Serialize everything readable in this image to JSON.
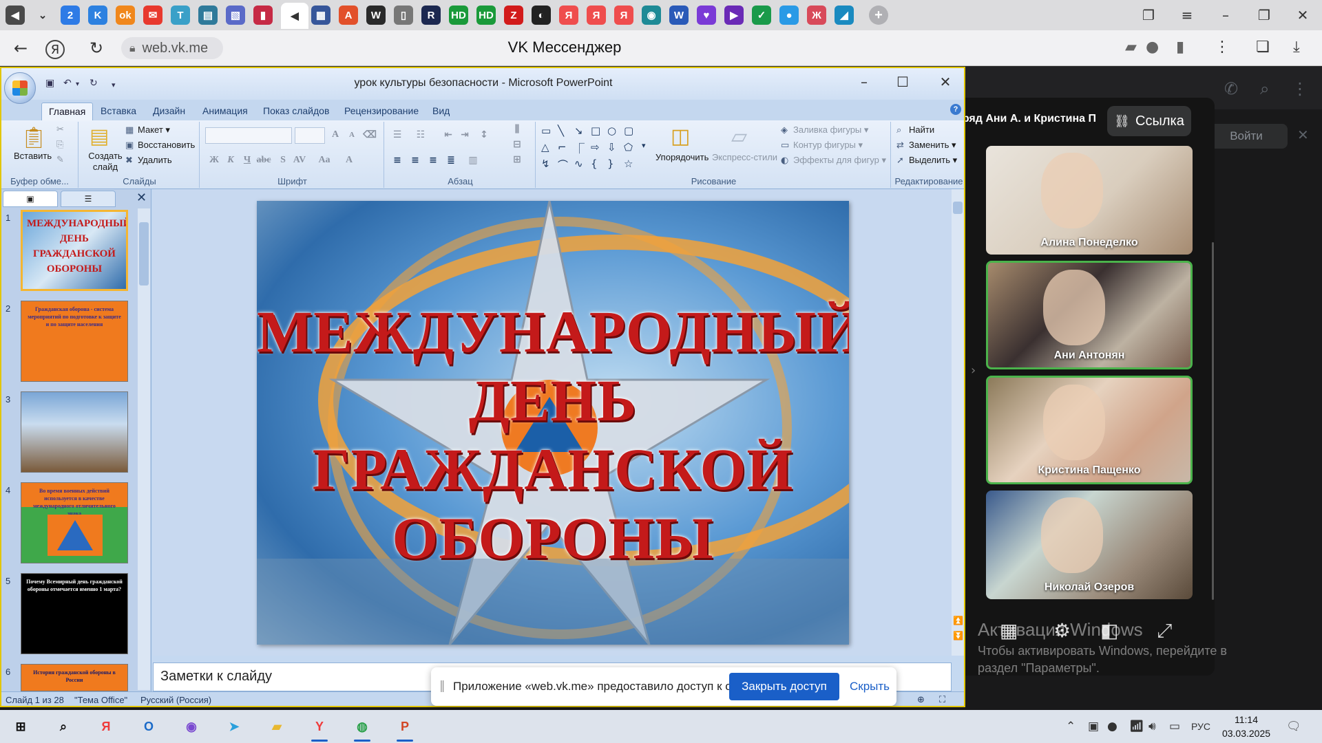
{
  "browser": {
    "tab_icons": [
      {
        "name": "speaker-tab-icon",
        "glyph": "◀",
        "bg": "#4a4a4a"
      },
      {
        "name": "tab-list-chevron-icon",
        "glyph": "⌄",
        "bg": "transparent"
      },
      {
        "name": "tab-2",
        "glyph": "2",
        "bg": "#2e7be6"
      },
      {
        "name": "tab-vk",
        "glyph": "K",
        "bg": "#2d81e0"
      },
      {
        "name": "tab-ok",
        "glyph": "ok",
        "bg": "#f0871c"
      },
      {
        "name": "tab-mail",
        "glyph": "✉",
        "bg": "#e8392e"
      },
      {
        "name": "tab-t",
        "glyph": "T",
        "bg": "#3aa0c8"
      },
      {
        "name": "tab-edu",
        "glyph": "▤",
        "bg": "#2f7a9a"
      },
      {
        "name": "tab-doc",
        "glyph": "▧",
        "bg": "#5a6ac8"
      },
      {
        "name": "tab-red",
        "glyph": "▮",
        "bg": "#c62a45"
      },
      {
        "name": "tab-active-vk",
        "glyph": "◀",
        "bg": "#ffffff"
      },
      {
        "name": "tab-m",
        "glyph": "▦",
        "bg": "#36569a"
      },
      {
        "name": "tab-a",
        "glyph": "A",
        "bg": "#e2502a"
      },
      {
        "name": "tab-w",
        "glyph": "W",
        "bg": "#2a2a2a"
      },
      {
        "name": "tab-file",
        "glyph": "▯",
        "bg": "#777777"
      },
      {
        "name": "tab-r",
        "glyph": "R",
        "bg": "#1c2850"
      },
      {
        "name": "tab-hd1",
        "glyph": "HD",
        "bg": "#1a9a3a"
      },
      {
        "name": "tab-hd2",
        "glyph": "HD",
        "bg": "#1a9a3a"
      },
      {
        "name": "tab-z",
        "glyph": "Z",
        "bg": "#d21b1b"
      },
      {
        "name": "tab-round",
        "glyph": "◐",
        "bg": "#222222"
      },
      {
        "name": "tab-ya1",
        "glyph": "Я",
        "bg": "#ef4d4d"
      },
      {
        "name": "tab-ya2",
        "glyph": "Я",
        "bg": "#ef4d4d"
      },
      {
        "name": "tab-ya3",
        "glyph": "Я",
        "bg": "#ef4d4d"
      },
      {
        "name": "tab-cam",
        "glyph": "◉",
        "bg": "#1e8a96"
      },
      {
        "name": "tab-wd",
        "glyph": "W",
        "bg": "#2a5ab8"
      },
      {
        "name": "tab-shield",
        "glyph": "♥",
        "bg": "#7a3ad6"
      },
      {
        "name": "tab-flag",
        "glyph": "▶",
        "bg": "#6a2ab6"
      },
      {
        "name": "tab-check",
        "glyph": "✓",
        "bg": "#1a9a4a"
      },
      {
        "name": "tab-dots",
        "glyph": "●",
        "bg": "#2a9ae6"
      },
      {
        "name": "tab-tree",
        "glyph": "Ж",
        "bg": "#d84a5a"
      },
      {
        "name": "tab-pen",
        "glyph": "◢",
        "bg": "#1a8ac0"
      }
    ],
    "url": "web.vk.me",
    "page_title": "VK Мессенджер"
  },
  "vk": {
    "login_label": "Войти",
    "call_title": "ряд Ани А. и Кристина П.",
    "link_label": "Ссылка",
    "participants": [
      {
        "name": "Алина Понеделко",
        "speaking": false,
        "bg": "linear-gradient(135deg,#e9e4dc 0%,#d9cdbd 55%,#a58a70 100%)"
      },
      {
        "name": "Ани Антонян",
        "speaking": true,
        "bg": "linear-gradient(135deg,#a68a6c 0%,#3a3030 40%,#bdb2a2 70%,#7a6050 100%)"
      },
      {
        "name": "Кристина Пащенко",
        "speaking": true,
        "bg": "linear-gradient(135deg,#8c7a5a 0%,#e6d2bf 40%,#d0a48a 70%,#c8b8a8 100%)"
      },
      {
        "name": "Николай Озеров",
        "speaking": false,
        "bg": "linear-gradient(135deg,#3a5a8c 0%,#c8d6d0 35%,#9a8a7a 70%,#5a4a3a 100%)"
      }
    ]
  },
  "windows_watermark": {
    "title": "Активация Windows",
    "text": "Чтобы активировать Windows, перейдите в раздел \"Параметры\"."
  },
  "share_banner": {
    "text": "Приложение «web.vk.me» предоставило доступ к окну.",
    "stop_label": "Закрыть доступ",
    "hide_label": "Скрыть"
  },
  "ppt": {
    "window_title": "урок культуры безопасности - Microsoft PowerPoint",
    "tabs": [
      "Главная",
      "Вставка",
      "Дизайн",
      "Анимация",
      "Показ слайдов",
      "Рецензирование",
      "Вид"
    ],
    "groups": {
      "clipboard": {
        "label": "Буфер обме...",
        "paste": "Вставить"
      },
      "slides": {
        "label": "Слайды",
        "new_slide": "Создать слайд",
        "layout": "Макет",
        "reset": "Восстановить",
        "delete": "Удалить"
      },
      "font": {
        "label": "Шрифт"
      },
      "paragraph": {
        "label": "Абзац"
      },
      "drawing": {
        "label": "Рисование",
        "arrange": "Упорядочить",
        "quick_styles": "Экспресс-стили",
        "fill": "Заливка фигуры",
        "outline": "Контур фигуры",
        "effects": "Эффекты для фигур"
      },
      "editing": {
        "label": "Редактирование",
        "find": "Найти",
        "replace": "Заменить",
        "select": "Выделить"
      }
    },
    "slide_lines": [
      "МЕЖДУНАРОДНЫЙ",
      "ДЕНЬ",
      "ГРАЖДАНСКОЙ",
      "ОБОРОНЫ"
    ],
    "thumbnails": [
      {
        "num": "1",
        "bg": "linear-gradient(135deg,#6aa6da,#d8e8f5 50%,#2f6cab)",
        "text": "МЕЖДУНАРОДНЫЙ ДЕНЬ ГРАЖДАНСКОЙ ОБОРОНЫ",
        "fg": "#c41a1a"
      },
      {
        "num": "2",
        "bg": "#f07a1e",
        "text": "Гражданская оборона - система мероприятий по подготовке к защите и по защите населения",
        "fg": "#3a2a8a"
      },
      {
        "num": "3",
        "bg": "linear-gradient(#7aa6d6,#c9dcef 40%,#7a5a3a)",
        "text": "",
        "fg": "#222"
      },
      {
        "num": "4",
        "bg": "linear-gradient(#f07a1e 0 30%,#3fa84a 30%)",
        "text": "Во время военных действий используется в качестве международного отличительного знака",
        "fg": "#3a2a8a"
      },
      {
        "num": "5",
        "bg": "#000000",
        "text": "Почему Всемирный день гражданской обороны отмечается именно 1 марта?",
        "fg": "#ffffff"
      },
      {
        "num": "6",
        "bg": "#f07a1e",
        "text": "История гражданской обороны в России",
        "fg": "#1a1a6a"
      }
    ],
    "notes_placeholder": "Заметки к слайду",
    "status": {
      "slide": "Слайд 1 из 28",
      "theme": "\"Тема Office\"",
      "lang": "Русский (Россия)"
    }
  },
  "taskbar": {
    "apps": [
      {
        "name": "start-button",
        "glyph": "⊞",
        "color": "#111"
      },
      {
        "name": "search-button",
        "glyph": "⌕",
        "color": "#111"
      },
      {
        "name": "yandex-app",
        "glyph": "Я",
        "color": "#ef3b3b"
      },
      {
        "name": "outlook-app",
        "glyph": "O",
        "color": "#1a6ac8"
      },
      {
        "name": "viber-app",
        "glyph": "◉",
        "color": "#7a4ad0"
      },
      {
        "name": "telegram-app",
        "glyph": "➤",
        "color": "#2aa0dc"
      },
      {
        "name": "explorer-app",
        "glyph": "▰",
        "color": "#e8b830"
      },
      {
        "name": "yandex-browser-app",
        "glyph": "Y",
        "color": "#ef3b3b"
      },
      {
        "name": "chrome-app",
        "glyph": "◍",
        "color": "#2aa04a"
      },
      {
        "name": "powerpoint-app",
        "glyph": "P",
        "color": "#d24726"
      }
    ],
    "lang": "РУС",
    "time": "11:14",
    "date": "03.03.2025"
  }
}
